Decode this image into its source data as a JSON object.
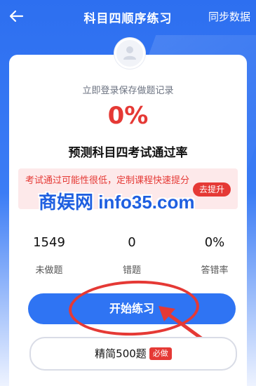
{
  "header": {
    "title": "科目四顺序练习",
    "sync_label": "同步数据"
  },
  "card": {
    "login_hint": "立即登录保存做题记录",
    "pass_rate": "0%",
    "pass_rate_label": "预测科目四考试通过率"
  },
  "warning": {
    "text": "考试通过可能性很低，定制课程快速提分",
    "button": "去提升"
  },
  "watermark": "商娱网 info35.com",
  "stats": [
    {
      "value": "1549",
      "label": "未做题"
    },
    {
      "value": "0",
      "label": "错题"
    },
    {
      "value": "0%",
      "label": "答错率"
    }
  ],
  "buttons": {
    "start": "开始练习",
    "simplified": "精简500题",
    "must_badge": "必做"
  },
  "colors": {
    "primary": "#2f74f3",
    "accent_red": "#e53935"
  }
}
